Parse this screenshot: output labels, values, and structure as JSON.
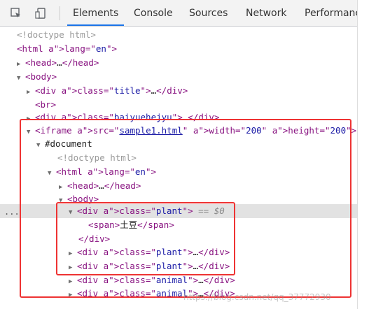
{
  "toolbar": {
    "icons": [
      "inspect-element-icon",
      "device-toolbar-icon"
    ],
    "tabs": [
      "Elements",
      "Console",
      "Sources",
      "Network",
      "Performanc"
    ]
  },
  "lines": [
    "<!doctype html>",
    "<html lang=\"en\">",
    "<head>…</head>",
    "<body>",
    "<div class=\"title\">…</div>",
    "<br>",
    "<div class=\"baiyuehejyu\">…</div>",
    "<iframe src=\"sample1.html\" width=\"200\" height=\"200\">",
    "#document",
    "<!doctype html>",
    "<html lang=\"en\">",
    "<head>…</head>",
    "<body>",
    "<div class=\"plant\"> == $0",
    "<span>土豆</span>",
    "</div>",
    "<div class=\"plant\">…</div>",
    "<div class=\"plant\">…</div>",
    "<div class=\"animal\">…</div>",
    "<div class=\"animal\">…</div>"
  ],
  "gutter_text": "...",
  "watermark": "https://blog.csdn.net/qq_37772930",
  "colors": {
    "highlight_box": "#e33333",
    "selected_row": "#e2e2e2",
    "active_tab": "#1a73e8"
  }
}
